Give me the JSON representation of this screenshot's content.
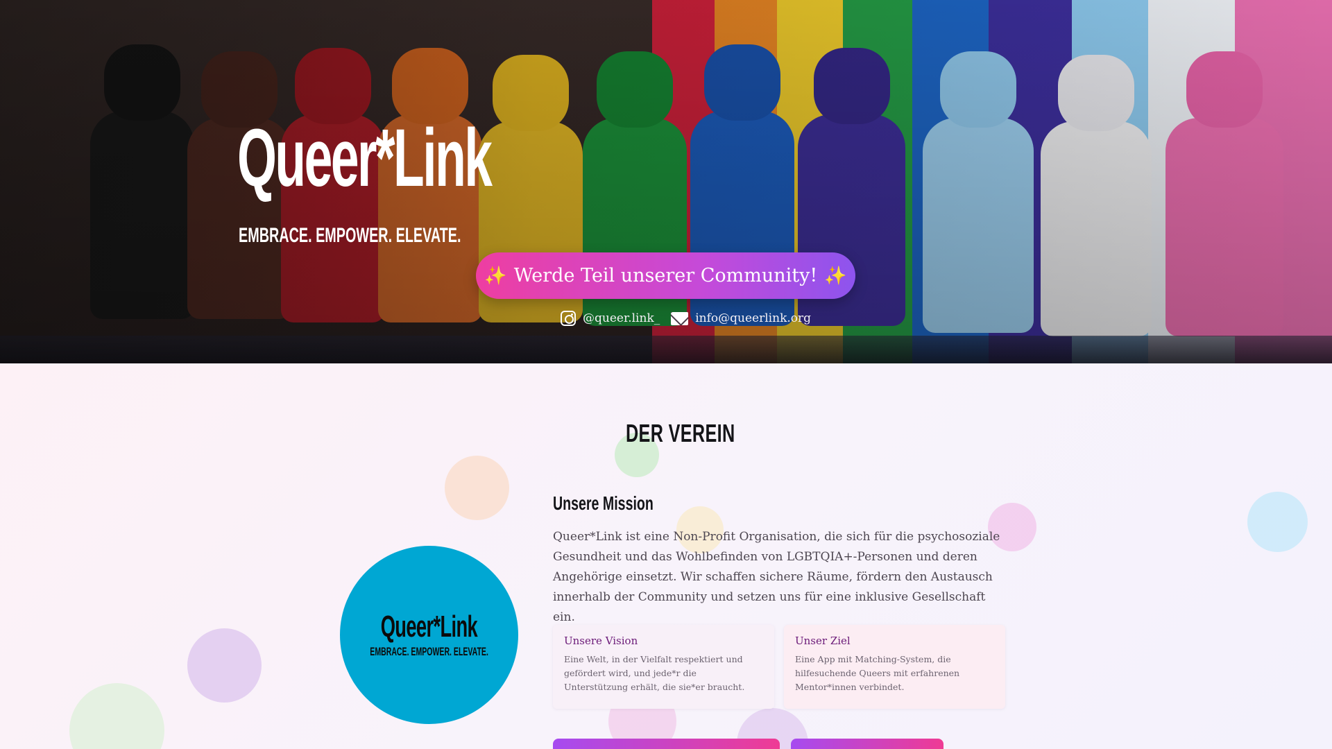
{
  "hero": {
    "title": "Queer*Link",
    "tagline": "EMBRACE. EMPOWER. ELEVATE.",
    "cta_label": "Werde Teil unserer Community!",
    "cta_sparkle": "✨",
    "instagram": "@queer.link_",
    "email": "info@queerlink.org"
  },
  "about": {
    "section_title": "DER VEREIN",
    "logo_name": "Queer*Link",
    "logo_tagline": "EMBRACE. EMPOWER. ELEVATE.",
    "mission_title": "Unsere Mission",
    "mission_text": "Queer*Link ist eine Non-Profit Organisation, die sich für die psychosoziale Gesundheit und das Wohlbefinden von LGBTQIA+-Personen und deren Angehörige einsetzt. Wir schaffen sichere Räume, fördern den Austausch innerhalb der Community und setzen uns für eine inklusive Gesellschaft ein.",
    "cards": [
      {
        "title": "Unsere Vision",
        "text": "Eine Welt, in der Vielfalt respektiert und gefördert wird, und jede*r die Unterstützung erhält, die sie*er braucht."
      },
      {
        "title": "Unser Ziel",
        "text": "Eine App mit Matching-System, die hilfesuchende Queers mit erfahrenen Mentor*innen verbindet."
      }
    ]
  },
  "colors": {
    "cta_start": "#ee3ea1",
    "cta_end": "#8d54ee",
    "logo_bg": "#00a7d3",
    "card_title": "#6b1a78"
  }
}
